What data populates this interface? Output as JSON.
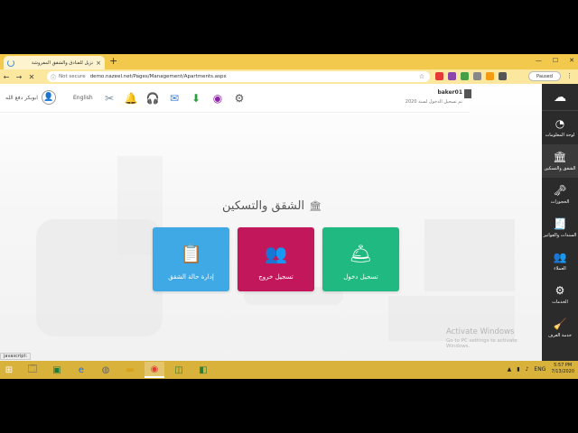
{
  "browser": {
    "tab_title": "نزيل للفنادق والشقق المفروشة",
    "tab_close": "×",
    "new_tab": "+",
    "nav_back": "←",
    "nav_forward": "→",
    "nav_reload": "✕",
    "info_icon": "ⓘ",
    "not_secure": "Not secure",
    "url": "demo.nazeel.net/Pages/Management/Apartments.aspx",
    "star": "☆",
    "paused": "Paused",
    "menu": "⋮",
    "win_min": "—",
    "win_max": "☐",
    "win_close": "✕",
    "ext_colors": [
      "#e53935",
      "#8e44ad",
      "#43a047",
      "#888888",
      "#f39c12",
      "#555555"
    ]
  },
  "topbar": {
    "user_name": "ابوبكر دفع الله",
    "language": "English",
    "account_name": "baker01",
    "last_login": "تم تسجيل الدخول لسنة 2020"
  },
  "heading": "الشقق والتسكين",
  "cards": {
    "blue": "إدارة حالة الشقق",
    "red": "تسجيل خروج",
    "green": "تسجيل دخول"
  },
  "sidebar": {
    "items": [
      "لوحة المعلومات",
      "الشقق والتسكين",
      "الحجوزات",
      "السندات والفواتير",
      "العملاء",
      "الخدمات",
      "خدمة الغرف"
    ]
  },
  "watermark": {
    "line1": "Activate Windows",
    "line2": "Go to PC settings to activate Windows."
  },
  "statusbar": "javascript:",
  "tray": {
    "time": "5:57 PM",
    "date": "7/13/2020",
    "kb_label": "ENG"
  }
}
